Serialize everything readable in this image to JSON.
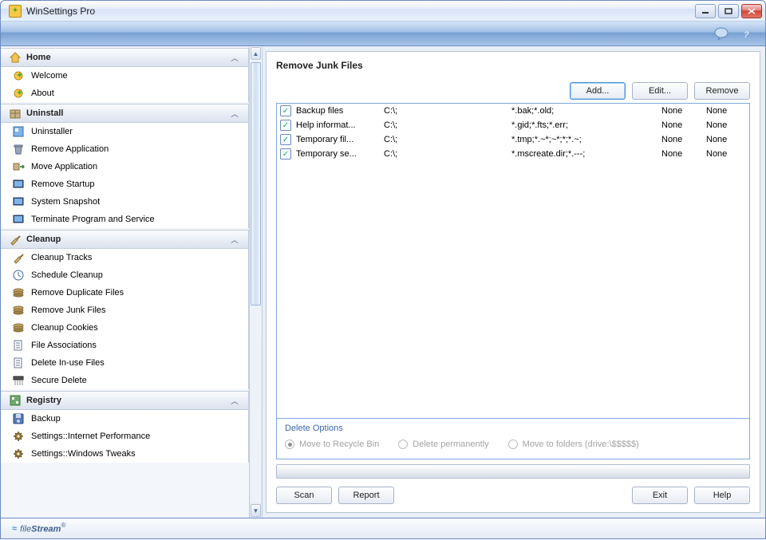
{
  "window": {
    "title": "WinSettings Pro"
  },
  "ribbon": {
    "chat_icon": "chat-icon",
    "help_icon": "help-icon"
  },
  "sidebar": {
    "sections": [
      {
        "title": "Home",
        "icon": "home-icon",
        "items": [
          {
            "label": "Welcome",
            "icon": "star-icon"
          },
          {
            "label": "About",
            "icon": "star-icon"
          }
        ]
      },
      {
        "title": "Uninstall",
        "icon": "package-icon",
        "items": [
          {
            "label": "Uninstaller",
            "icon": "app-icon"
          },
          {
            "label": "Remove Application",
            "icon": "trash-icon"
          },
          {
            "label": "Move Application",
            "icon": "move-icon"
          },
          {
            "label": "Remove Startup",
            "icon": "screen-icon"
          },
          {
            "label": "System Snapshot",
            "icon": "screen-icon"
          },
          {
            "label": "Terminate Program and Service",
            "icon": "screen-icon"
          }
        ]
      },
      {
        "title": "Cleanup",
        "icon": "broom-icon",
        "items": [
          {
            "label": "Cleanup Tracks",
            "icon": "broom-icon"
          },
          {
            "label": "Schedule Cleanup",
            "icon": "clock-icon"
          },
          {
            "label": "Remove Duplicate Files",
            "icon": "stack-icon"
          },
          {
            "label": "Remove Junk Files",
            "icon": "stack-icon"
          },
          {
            "label": "Cleanup Cookies",
            "icon": "stack-icon"
          },
          {
            "label": "File Associations",
            "icon": "doc-icon"
          },
          {
            "label": "Delete In-use Files",
            "icon": "doc-icon"
          },
          {
            "label": "Secure Delete",
            "icon": "shred-icon"
          }
        ]
      },
      {
        "title": "Registry",
        "icon": "registry-icon",
        "items": [
          {
            "label": "Backup",
            "icon": "disk-icon"
          },
          {
            "label": "Settings::Internet Performance",
            "icon": "gear-icon"
          },
          {
            "label": "Settings::Windows Tweaks",
            "icon": "gear-icon"
          }
        ]
      }
    ]
  },
  "content": {
    "title": "Remove Junk Files",
    "buttons": {
      "add": "Add...",
      "edit": "Edit...",
      "remove": "Remove"
    },
    "rows": [
      {
        "checked": true,
        "name": "Backup files",
        "drive": "C:\\;",
        "mask": "*.bak;*.old;",
        "c1": "None",
        "c2": "None"
      },
      {
        "checked": true,
        "name": "Help informat...",
        "drive": "C:\\;",
        "mask": "*.gid;*.fts;*.err;",
        "c1": "None",
        "c2": "None"
      },
      {
        "checked": true,
        "name": "Temporary fil...",
        "drive": "C:\\;",
        "mask": "*.tmp;*.~*;~*;*;*.~;",
        "c1": "None",
        "c2": "None"
      },
      {
        "checked": true,
        "name": "Temporary se...",
        "drive": "C:\\;",
        "mask": "*.mscreate.dir;*.---;",
        "c1": "None",
        "c2": "None"
      }
    ],
    "delete_options": {
      "legend": "Delete Options",
      "opts": [
        "Move to Recycle Bin",
        "Delete permanently",
        "Move to folders (drive:\\$$$$$)"
      ],
      "selected": 0
    },
    "bottom": {
      "scan": "Scan",
      "report": "Report",
      "exit": "Exit",
      "help": "Help"
    }
  },
  "footer": {
    "brand_pre": "file",
    "brand_bold": "Stream"
  }
}
